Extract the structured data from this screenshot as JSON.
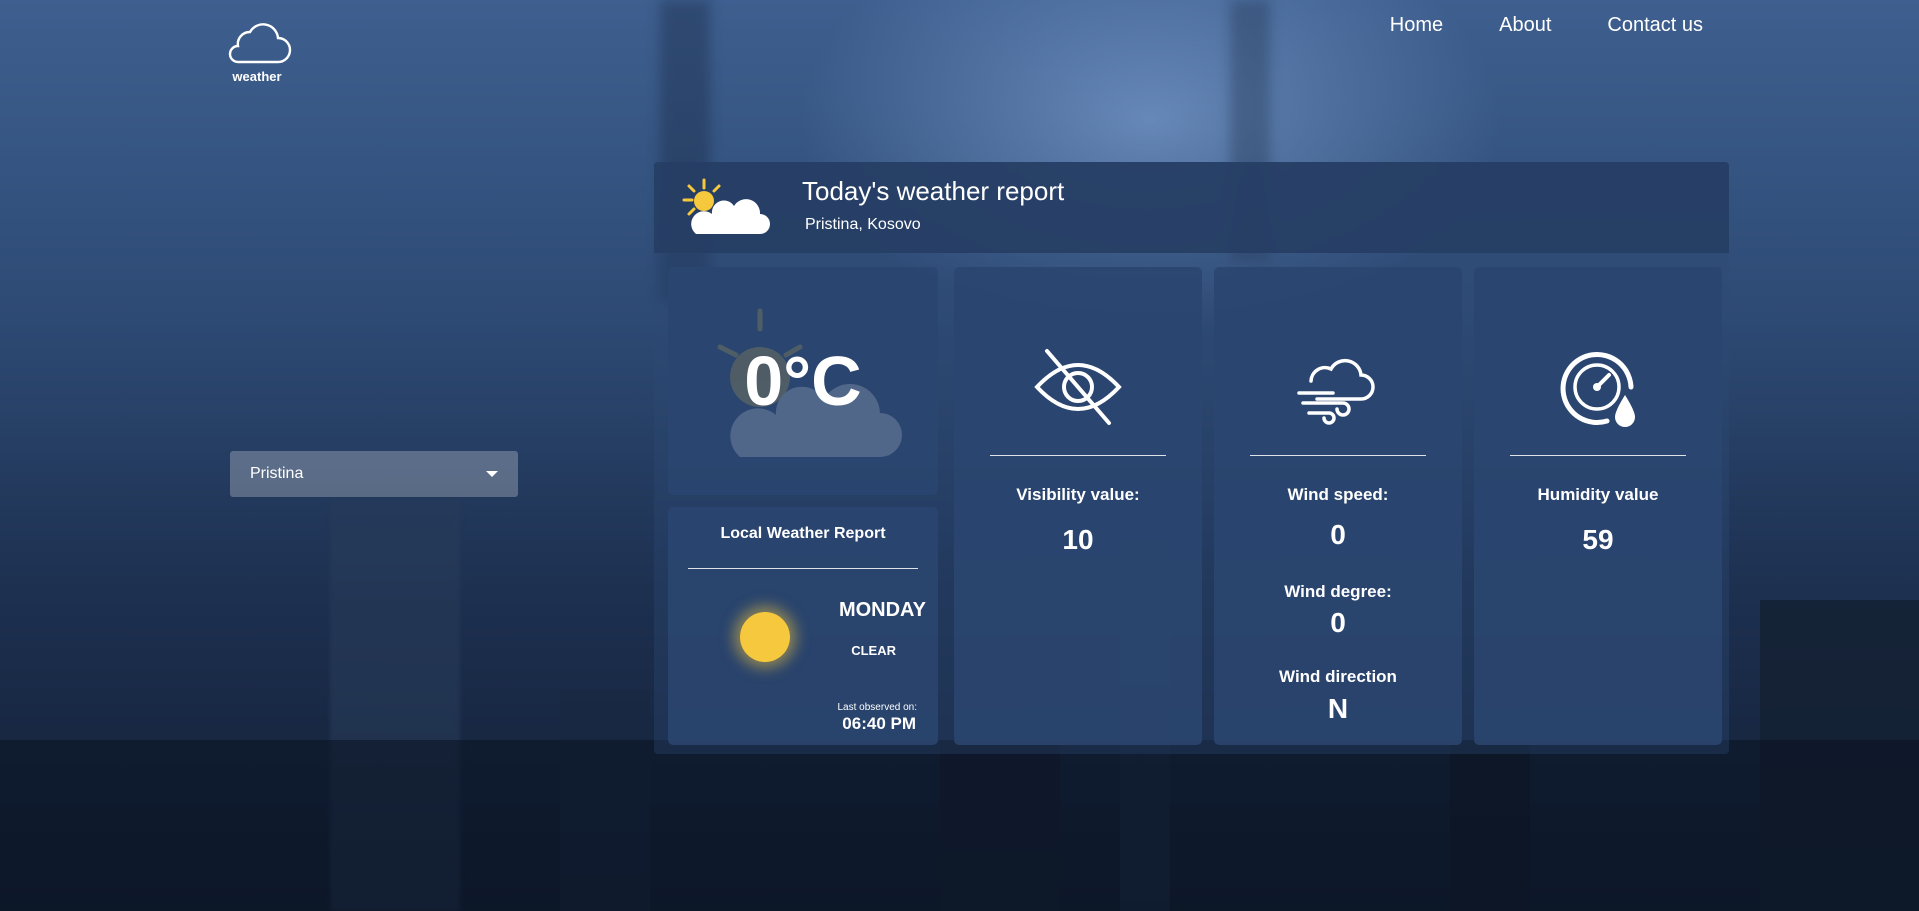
{
  "logo": {
    "text": "weather",
    "icon": "cloud-outline-icon"
  },
  "nav": {
    "home": "Home",
    "about": "About",
    "contact": "Contact us"
  },
  "city_select": {
    "selected": "Pristina"
  },
  "report": {
    "title": "Today's weather report",
    "location": "Pristina, Kosovo",
    "header_icon": "partly-sunny-icon"
  },
  "temperature": {
    "value": "0°C"
  },
  "local": {
    "title": "Local Weather Report",
    "day": "MONDAY",
    "condition": "CLEAR",
    "observed_label": "Last observed on:",
    "observed_time": "06:40 PM",
    "icon": "sun-icon"
  },
  "visibility": {
    "label": "Visibility value:",
    "value": "10",
    "icon": "eye-slash-icon"
  },
  "wind": {
    "speed_label": "Wind speed:",
    "speed_value": "0",
    "degree_label": "Wind degree:",
    "degree_value": "0",
    "direction_label": "Wind direction",
    "direction_value": "N",
    "icon": "cloud-wind-icon"
  },
  "humidity": {
    "label": "Humidity value",
    "value": "59",
    "icon": "gauge-droplet-icon"
  },
  "colors": {
    "sun": "#f6c83e",
    "panel": "#2a4670",
    "background": "#2d4a74"
  }
}
